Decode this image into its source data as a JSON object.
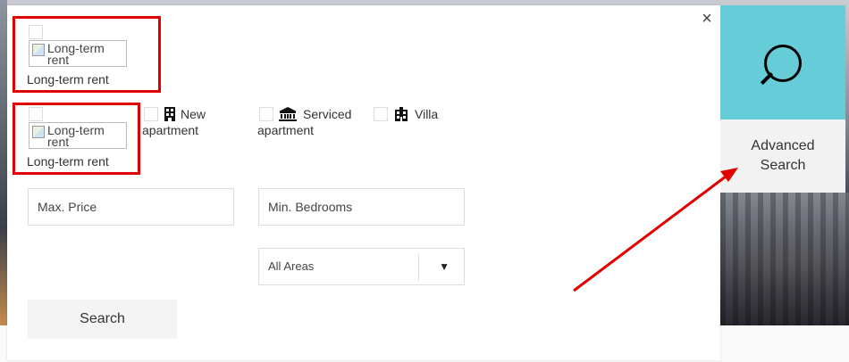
{
  "close_glyph": "×",
  "property_types": [
    {
      "label": "Long-term rent",
      "img_alt": "Long-term rent"
    },
    {
      "label": "Long-term rent",
      "img_alt": "Long-term rent"
    },
    {
      "label": "New apartment",
      "label_line1": "New",
      "label_line2": "apartment",
      "icon": "building-icon"
    },
    {
      "label": "Serviced apartment",
      "label_line1": "Serviced",
      "label_line2": "apartment",
      "icon": "bank-icon"
    },
    {
      "label": "Villa",
      "icon": "villa-icon"
    }
  ],
  "fields": {
    "max_price_placeholder": "Max. Price",
    "min_bedrooms_placeholder": "Min. Bedrooms",
    "area_selected": "All Areas",
    "dropdown_glyph": "▼"
  },
  "search_button": "Search",
  "advanced_search": {
    "line1": "Advanced",
    "line2": "Search",
    "icon": "magnifier-icon"
  },
  "colors": {
    "accent_teal": "#66cdd8",
    "highlight_red": "#e00000"
  }
}
